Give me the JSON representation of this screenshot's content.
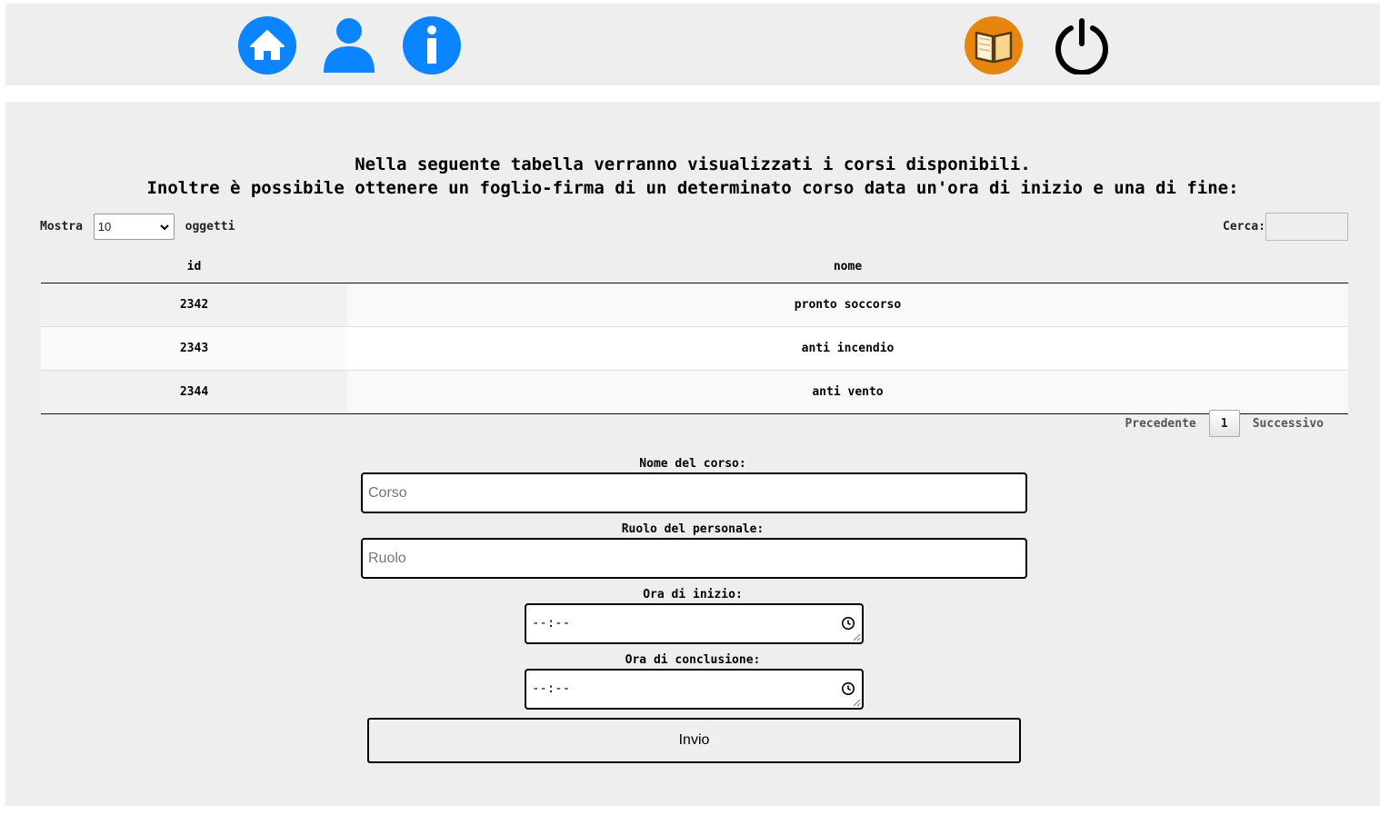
{
  "nav": {
    "left_icons": [
      "home-icon",
      "user-icon",
      "info-icon"
    ],
    "right_icons": [
      "book-icon",
      "power-icon"
    ],
    "colors": {
      "blue": "#0a84ff",
      "orange": "#e8850f",
      "power": "#000000"
    }
  },
  "intro": {
    "line1": "Nella seguente tabella verranno visualizzati i corsi disponibili.",
    "line2": "Inoltre è possibile ottenere un foglio-firma di un determinato corso data un'ora di inizio e una di fine:"
  },
  "table_controls": {
    "show_label": "Mostra",
    "show_value": "10",
    "show_suffix": "oggetti",
    "search_label": "Cerca:",
    "search_value": ""
  },
  "table": {
    "columns": [
      "id",
      "nome"
    ],
    "rows": [
      [
        "2342",
        "pronto soccorso"
      ],
      [
        "2343",
        "anti incendio"
      ],
      [
        "2344",
        "anti vento"
      ]
    ]
  },
  "pagination": {
    "prev": "Precedente",
    "current": "1",
    "next": "Successivo"
  },
  "form": {
    "course_label": "Nome del corso:",
    "course_placeholder": "Corso",
    "role_label": "Ruolo del personale:",
    "role_placeholder": "Ruolo",
    "start_label": "Ora di inizio:",
    "start_value": "--:--",
    "end_label": "Ora di conclusione:",
    "end_value": "--:--",
    "submit": "Invio"
  }
}
